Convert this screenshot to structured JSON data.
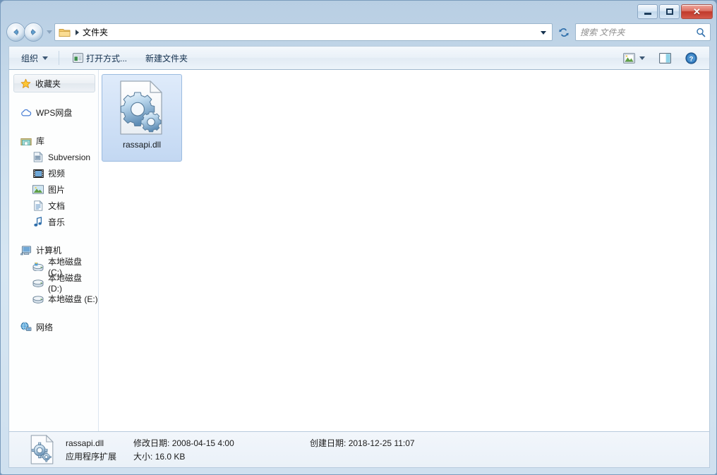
{
  "window": {
    "minimize_label": "–",
    "maximize_label": "□",
    "close_label": "✕"
  },
  "address_bar": {
    "back_title": "后退",
    "forward_title": "前进",
    "crumb_folder_icon": "folder-icon",
    "crumb_label": "文件夹",
    "refresh_icon": "refresh-icon"
  },
  "search": {
    "placeholder": "搜索 文件夹",
    "icon": "search-icon"
  },
  "toolbar": {
    "organize_label": "组织",
    "open_with_label": "打开方式...",
    "new_folder_label": "新建文件夹",
    "view_icon": "view-icon",
    "preview_pane_icon": "preview-pane-icon",
    "help_icon": "help-icon"
  },
  "sidebar": {
    "favorites": {
      "label": "收藏夹",
      "icon": "star-icon"
    },
    "wps": {
      "label": "WPS网盘",
      "icon": "cloud-icon"
    },
    "library": {
      "label": "库",
      "icon": "library-icon",
      "items": [
        {
          "label": "Subversion",
          "icon": "subversion-icon"
        },
        {
          "label": "视频",
          "icon": "video-icon"
        },
        {
          "label": "图片",
          "icon": "picture-icon"
        },
        {
          "label": "文档",
          "icon": "document-icon"
        },
        {
          "label": "音乐",
          "icon": "music-icon"
        }
      ]
    },
    "computer": {
      "label": "计算机",
      "icon": "computer-icon",
      "items": [
        {
          "label": "本地磁盘 (C:)",
          "icon": "system-drive-icon"
        },
        {
          "label": "本地磁盘 (D:)",
          "icon": "drive-icon"
        },
        {
          "label": "本地磁盘 (E:)",
          "icon": "drive-icon"
        }
      ]
    },
    "network": {
      "label": "网络",
      "icon": "network-icon"
    }
  },
  "content": {
    "files": [
      {
        "name": "rassapi.dll",
        "icon": "dll-gear-icon",
        "selected": true
      }
    ]
  },
  "status": {
    "icon": "dll-gear-icon",
    "name": "rassapi.dll",
    "type": "应用程序扩展",
    "modified_label": "修改日期:",
    "modified_value": "2008-04-15 4:00",
    "created_label": "创建日期:",
    "created_value": "2018-12-25 11:07",
    "size_label": "大小:",
    "size_value": "16.0 KB"
  },
  "colors": {
    "frame": "#c9dcec",
    "selection": "#cfe0f6",
    "close_button": "#c0392b",
    "accent": "#2c6fae"
  }
}
